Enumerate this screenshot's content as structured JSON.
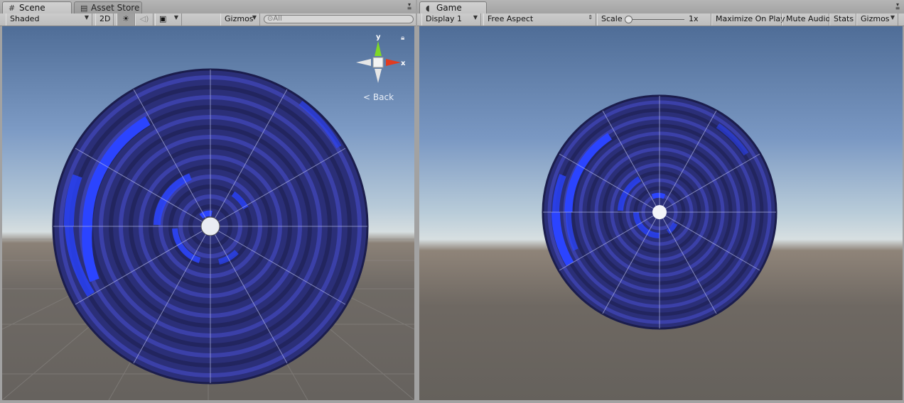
{
  "scene_panel": {
    "tabs": [
      {
        "label": "Scene",
        "icon": "grid-icon"
      },
      {
        "label": "Asset Store",
        "icon": "store-icon"
      }
    ],
    "toolbar": {
      "draw_mode": "Shaded",
      "mode_2d": "2D",
      "gizmos": "Gizmos",
      "search_placeholder": "All"
    },
    "orientation_gizmo": {
      "axis_y": "y",
      "axis_x": "x",
      "view_label": "Back"
    }
  },
  "game_panel": {
    "tab": {
      "label": "Game",
      "icon": "pacman-icon"
    },
    "toolbar": {
      "display": "Display 1",
      "aspect": "Free Aspect",
      "scale_label": "Scale",
      "scale_value": "1x",
      "maximize": "Maximize On Play",
      "mute": "Mute Audio",
      "stats": "Stats",
      "gizmos": "Gizmos"
    }
  },
  "colors": {
    "disc_dark": "#2a2e6e",
    "disc_highlight": "#2e45ff",
    "sky": "#7d9bc5",
    "ground": "#6b6661"
  }
}
